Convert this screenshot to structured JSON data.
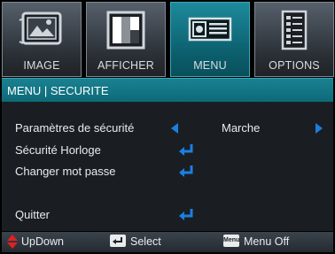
{
  "tabs": [
    {
      "label": "IMAGE",
      "icon": "image-icon",
      "active": false
    },
    {
      "label": "AFFICHER",
      "icon": "display-icon",
      "active": false
    },
    {
      "label": "MENU",
      "icon": "projector-menu-icon",
      "active": true
    },
    {
      "label": "OPTIONS",
      "icon": "options-icon",
      "active": false
    }
  ],
  "section_title": "MENU | SECURITE",
  "rows": {
    "security_settings": {
      "label": "Paramètres de sécurité",
      "value": "Marche"
    },
    "security_timer": {
      "label": "Sécurité Horloge"
    },
    "change_password": {
      "label": "Changer mot passe"
    },
    "exit": {
      "label": "Quitter"
    }
  },
  "footer": {
    "updown": "UpDown",
    "select": "Select",
    "menu_key": "Menu",
    "menu_off": "Menu Off"
  },
  "colors": {
    "active_tab": "#0d6a78",
    "accent_blue": "#1c7fe0",
    "updown_red": "#e02020"
  }
}
